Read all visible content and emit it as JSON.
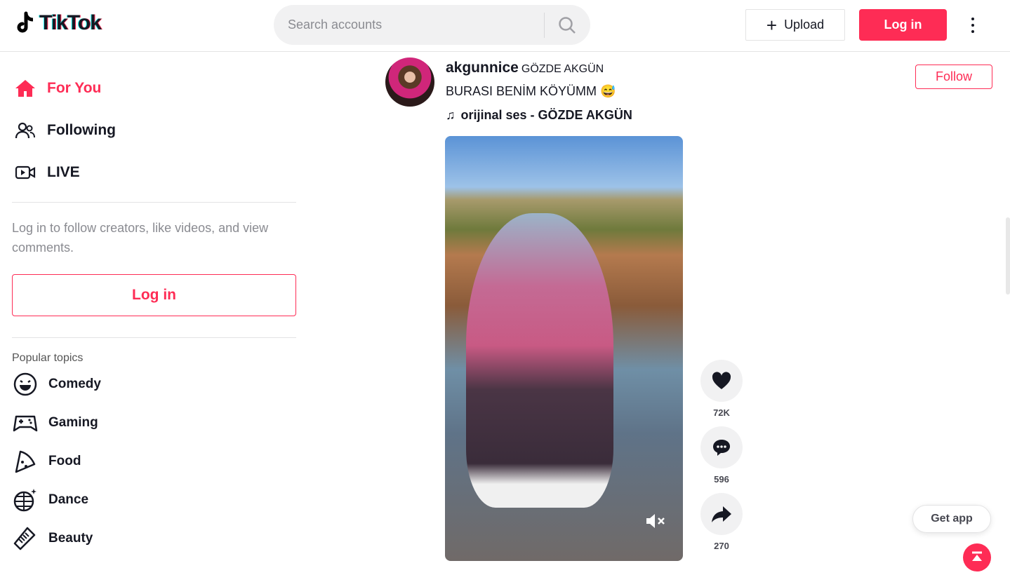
{
  "header": {
    "logo": "TikTok",
    "search_placeholder": "Search accounts",
    "upload": "Upload",
    "login": "Log in"
  },
  "sidebar": {
    "nav": [
      {
        "label": "For You",
        "icon": "home-icon",
        "active": true
      },
      {
        "label": "Following",
        "icon": "users-icon"
      },
      {
        "label": "LIVE",
        "icon": "live-icon"
      }
    ],
    "hint": "Log in to follow creators, like videos, and view comments.",
    "login": "Log in",
    "topics_heading": "Popular topics",
    "topics": [
      {
        "label": "Comedy",
        "icon": "smile-icon"
      },
      {
        "label": "Gaming",
        "icon": "gamepad-icon"
      },
      {
        "label": "Food",
        "icon": "pizza-icon"
      },
      {
        "label": "Dance",
        "icon": "disco-ball-icon"
      },
      {
        "label": "Beauty",
        "icon": "comb-icon"
      }
    ]
  },
  "post": {
    "username": "akgunnice",
    "nickname": "GÖZDE AKGÜN",
    "caption": "BURASI BENİM KÖYÜMM 😅",
    "music": "orijinal ses - GÖZDE AKGÜN",
    "follow": "Follow",
    "likes": "72K",
    "comments": "596",
    "shares": "270"
  },
  "get_app": "Get app",
  "colors": {
    "accent": "#fe2c55"
  }
}
